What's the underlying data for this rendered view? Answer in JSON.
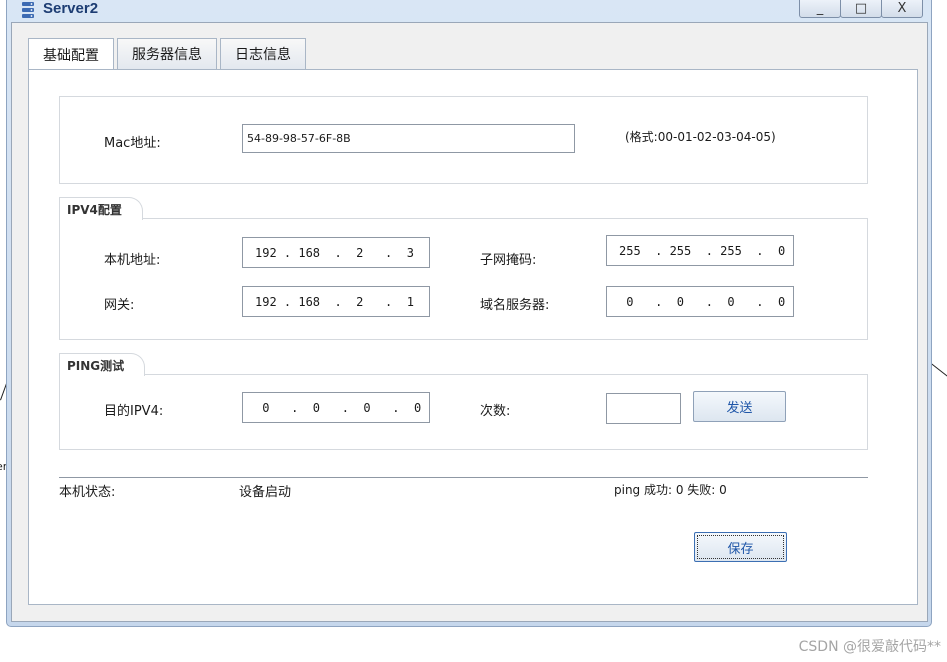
{
  "window": {
    "title": "Server2",
    "controls": {
      "minimize": "_",
      "maximize": "□",
      "close": "X"
    }
  },
  "tabs": [
    {
      "label": "基础配置",
      "active": true
    },
    {
      "label": "服务器信息",
      "active": false
    },
    {
      "label": "日志信息",
      "active": false
    }
  ],
  "mac_section": {
    "label": "Mac地址:",
    "value": "54-89-98-57-6F-8B",
    "format_hint": "(格式:00-01-02-03-04-05)"
  },
  "ipv4_section": {
    "title": "IPV4配置",
    "local_address_label": "本机地址:",
    "local_address": "192 . 168  .  2   .  3",
    "subnet_mask_label": "子网掩码:",
    "subnet_mask": "255  . 255  . 255  .  0",
    "gateway_label": "网关:",
    "gateway": "192 . 168  .  2   .  1",
    "dns_label": "域名服务器:",
    "dns": " 0   .  0   .  0   .  0"
  },
  "ping_section": {
    "title": "PING测试",
    "dest_label": "目的IPV4:",
    "dest": " 0   .  0   .  0   .  0",
    "count_label": "次数:",
    "count": "",
    "send_button": "发送"
  },
  "status": {
    "label": "本机状态:",
    "value": "设备启动",
    "ping_result": "ping 成功: 0 失败: 0"
  },
  "save_button": "保存",
  "background": {
    "stray_text": "er"
  },
  "watermark": "CSDN @很爱敲代码**",
  "colors": {
    "accent": "#1f56a8",
    "title": "#1d3d73",
    "frame": "#c6d7ec"
  },
  "icons": {
    "app": "server-icon"
  }
}
